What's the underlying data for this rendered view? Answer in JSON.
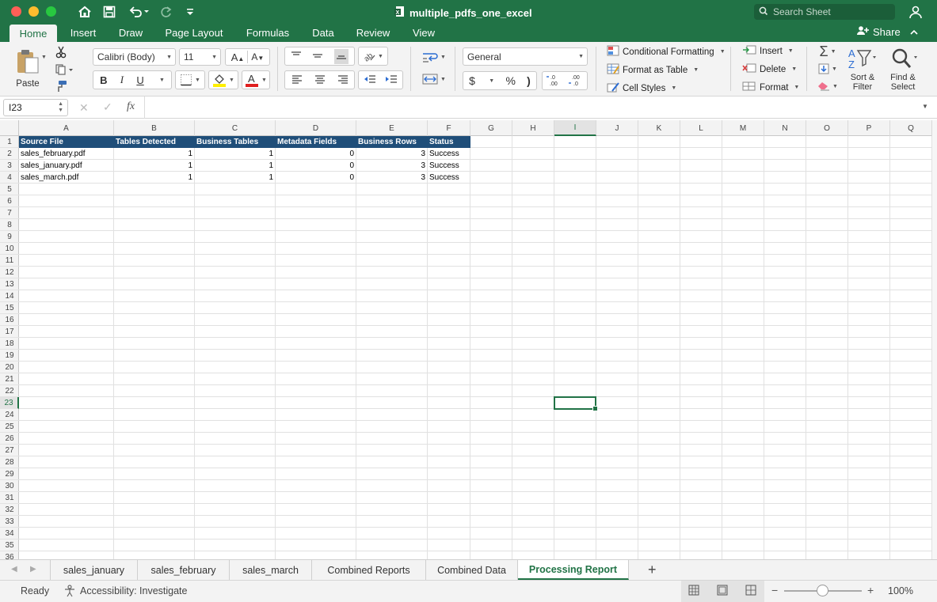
{
  "window": {
    "title": "multiple_pdfs_one_excel"
  },
  "search": {
    "placeholder": "Search Sheet"
  },
  "ribbon_tabs": [
    "Home",
    "Insert",
    "Draw",
    "Page Layout",
    "Formulas",
    "Data",
    "Review",
    "View"
  ],
  "active_ribbon_tab": "Home",
  "share_label": "Share",
  "ribbon": {
    "paste": "Paste",
    "font_name": "Calibri (Body)",
    "font_size": "11",
    "bold": "B",
    "italic": "I",
    "underline": "U",
    "number_format": "General",
    "currency": "$",
    "percent": "%",
    "comma": ")",
    "inc_decimal": "←.0 .00",
    "dec_decimal": ".00 →.0",
    "conditional_formatting": "Conditional Formatting",
    "format_as_table": "Format as Table",
    "cell_styles": "Cell Styles",
    "insert": "Insert",
    "delete": "Delete",
    "format": "Format",
    "sort_filter_1": "Sort &",
    "sort_filter_2": "Filter",
    "find_select_1": "Find &",
    "find_select_2": "Select"
  },
  "formula_bar": {
    "name_box": "I23",
    "fx": "fx",
    "value": ""
  },
  "columns": [
    "A",
    "B",
    "C",
    "D",
    "E",
    "F",
    "G",
    "H",
    "I",
    "J",
    "K",
    "L",
    "M",
    "N",
    "O",
    "P",
    "Q"
  ],
  "selected_column": "I",
  "selected_row": 23,
  "row_count": 36,
  "table": {
    "headers": [
      "Source File",
      "Tables Detected",
      "Business Tables",
      "Metadata Fields",
      "Business Rows",
      "Status"
    ],
    "rows": [
      [
        "sales_february.pdf",
        "1",
        "1",
        "0",
        "3",
        "Success"
      ],
      [
        "sales_january.pdf",
        "1",
        "1",
        "0",
        "3",
        "Success"
      ],
      [
        "sales_march.pdf",
        "1",
        "1",
        "0",
        "3",
        "Success"
      ]
    ],
    "header_color": "#1f4e79"
  },
  "sheet_tabs": [
    "sales_january",
    "sales_february",
    "sales_march",
    "Combined Reports",
    "Combined Data",
    "Processing Report"
  ],
  "active_sheet": "Processing Report",
  "status": {
    "ready": "Ready",
    "accessibility": "Accessibility: Investigate",
    "zoom": "100%"
  },
  "colors": {
    "accent": "#217346",
    "selection": "#217346"
  },
  "icons": [
    "home-icon",
    "save-icon",
    "undo-icon",
    "redo-icon",
    "customize-icon",
    "excel-file-icon",
    "search-icon",
    "account-icon",
    "share-icon",
    "collapse-ribbon-icon",
    "paste-icon",
    "cut-icon",
    "copy-icon",
    "format-painter-icon",
    "grow-font-icon",
    "shrink-font-icon",
    "borders-icon",
    "fill-color-icon",
    "font-color-icon",
    "align-top-icon",
    "align-middle-icon",
    "align-bottom-icon",
    "orientation-icon",
    "align-left-icon",
    "align-center-icon",
    "align-right-icon",
    "decrease-indent-icon",
    "increase-indent-icon",
    "wrap-text-icon",
    "merge-icon",
    "conditional-formatting-icon",
    "format-as-table-icon",
    "cell-styles-icon",
    "insert-cells-icon",
    "delete-cells-icon",
    "format-cells-icon",
    "autosum-icon",
    "fill-icon",
    "clear-icon",
    "sort-filter-icon",
    "find-select-icon",
    "cancel-icon",
    "enter-icon",
    "prev-sheet-icon",
    "next-sheet-icon",
    "add-sheet-icon",
    "accessibility-icon",
    "normal-view-icon",
    "page-layout-view-icon",
    "page-break-view-icon"
  ]
}
